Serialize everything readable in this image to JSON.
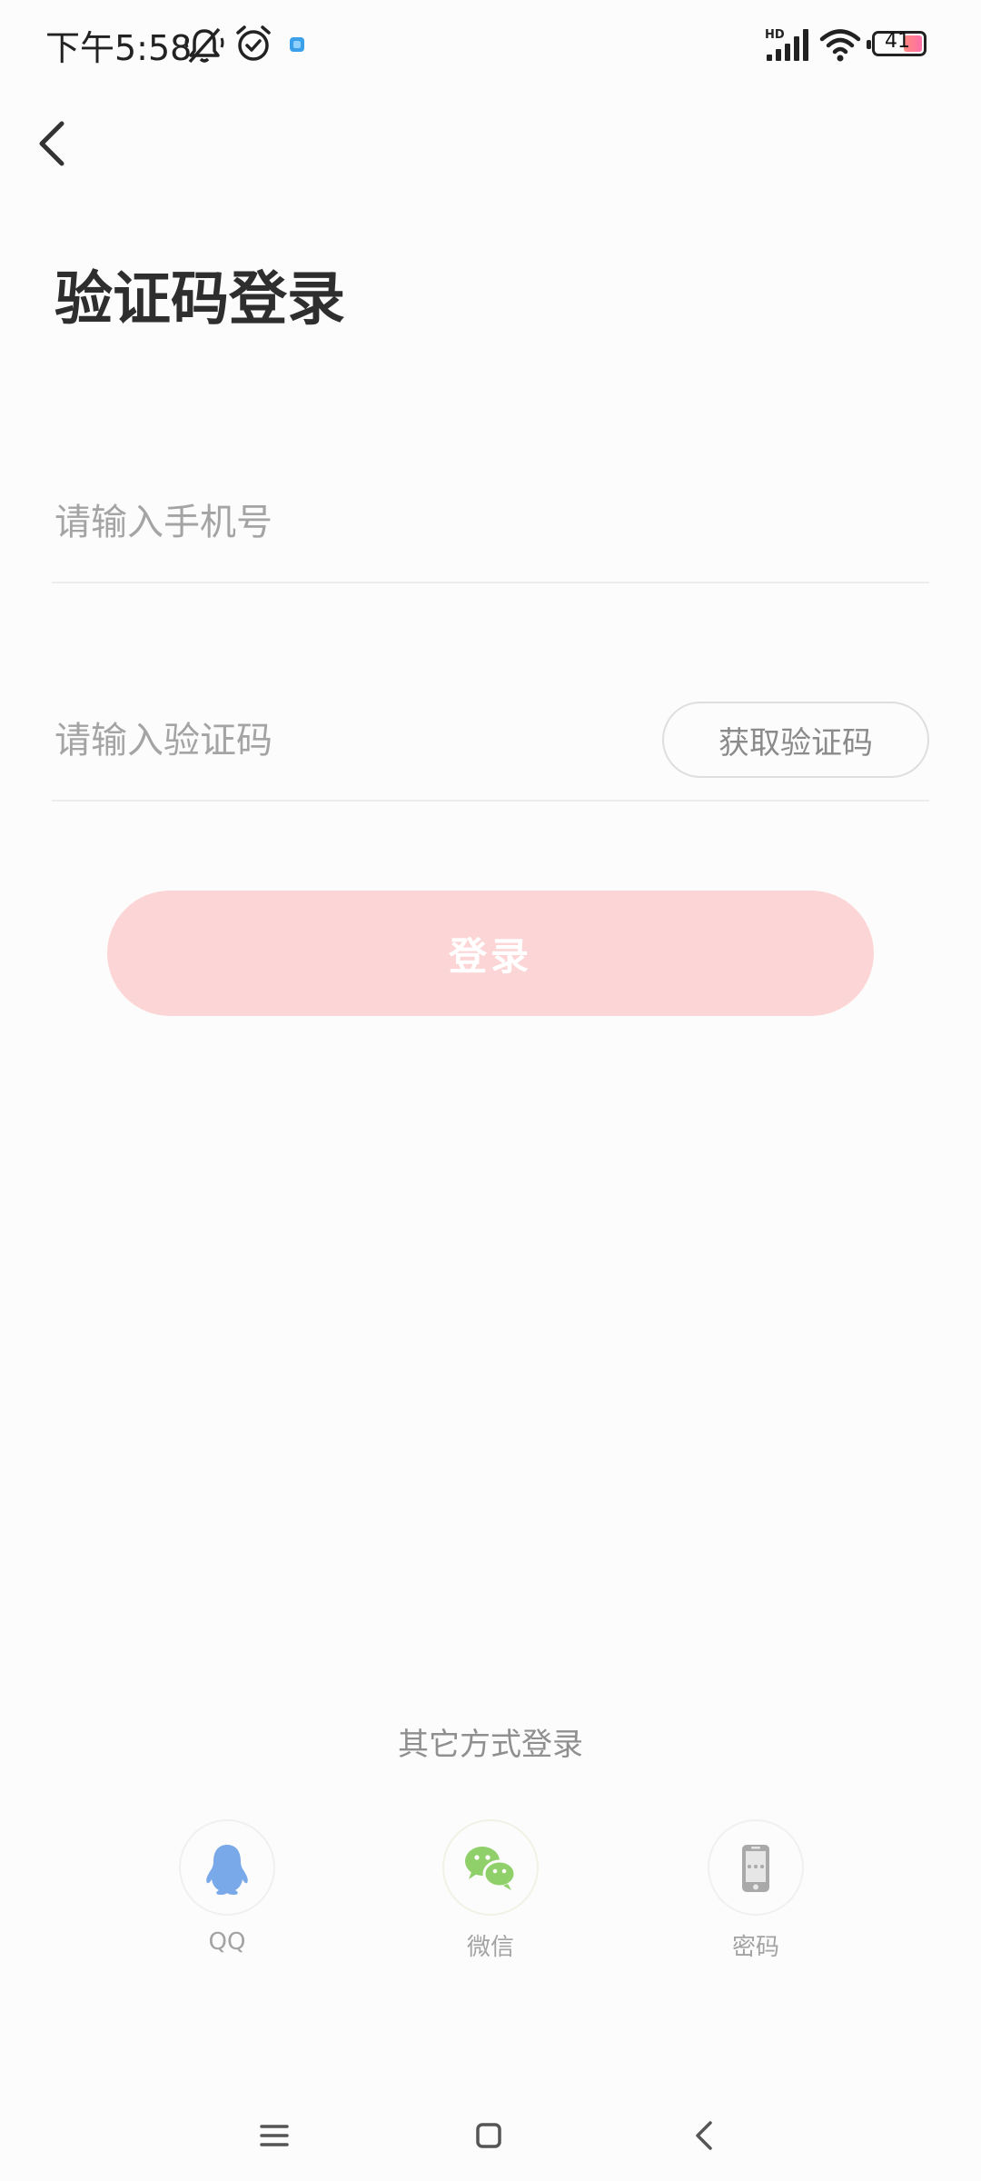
{
  "status_bar": {
    "time": "下午5:58",
    "battery_level": "41",
    "network": "HD",
    "icons": [
      "mute-bell-icon",
      "alarm-icon",
      "notification-app-icon",
      "signal-icon",
      "wifi-icon",
      "battery-icon"
    ]
  },
  "header": {
    "back_icon": "chevron-left-icon",
    "title": "验证码登录"
  },
  "form": {
    "phone_placeholder": "请输入手机号",
    "phone_value": "",
    "code_placeholder": "请输入验证码",
    "code_value": "",
    "get_code_label": "获取验证码",
    "login_label": "登录"
  },
  "other_login": {
    "title": "其它方式登录",
    "methods": [
      {
        "label": "QQ",
        "icon": "qq-penguin-icon",
        "color": "#7aa9ea"
      },
      {
        "label": "微信",
        "icon": "wechat-icon",
        "color": "#8fd06a"
      },
      {
        "label": "密码",
        "icon": "phone-password-icon",
        "color": "#a9a9a9"
      }
    ]
  },
  "nav_bar": {
    "icons": [
      "menu-icon",
      "home-icon",
      "back-icon"
    ]
  },
  "colors": {
    "accent_disabled": "#fcd6d6",
    "title": "#2e2e2e",
    "placeholder": "#a4a4a4"
  }
}
